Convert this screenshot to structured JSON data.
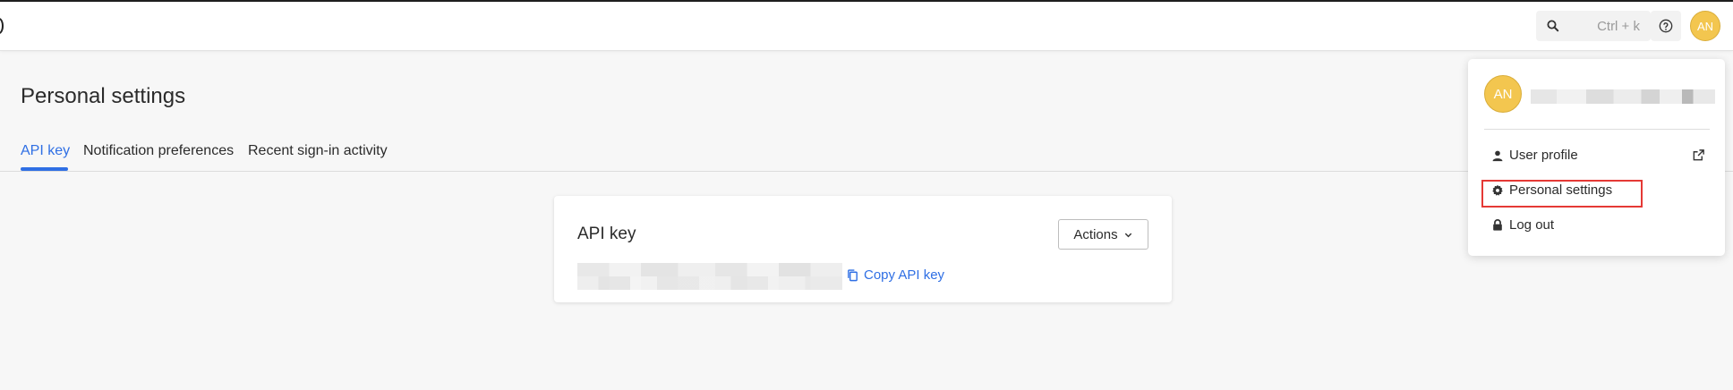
{
  "header": {
    "search": {
      "icon": "search-icon",
      "shortcut": "Ctrl + k"
    },
    "help_icon": "help-circle-icon",
    "avatar_initials": "AN"
  },
  "page": {
    "title": "Personal settings",
    "tabs": [
      {
        "label": "API key",
        "active": true
      },
      {
        "label": "Notification preferences",
        "active": false
      },
      {
        "label": "Recent sign-in activity",
        "active": false
      }
    ]
  },
  "api_card": {
    "title": "API key",
    "actions_label": "Actions",
    "copy_label": "Copy API key"
  },
  "user_menu": {
    "avatar_initials": "AN",
    "items": [
      {
        "label": "User profile",
        "icon": "person-icon"
      },
      {
        "label": "Personal settings",
        "icon": "gear-icon"
      },
      {
        "label": "Log out",
        "icon": "lock-icon"
      }
    ]
  },
  "colors": {
    "accent": "#2f6fe4",
    "avatar": "#f3c64f",
    "highlight": "#e53935"
  }
}
